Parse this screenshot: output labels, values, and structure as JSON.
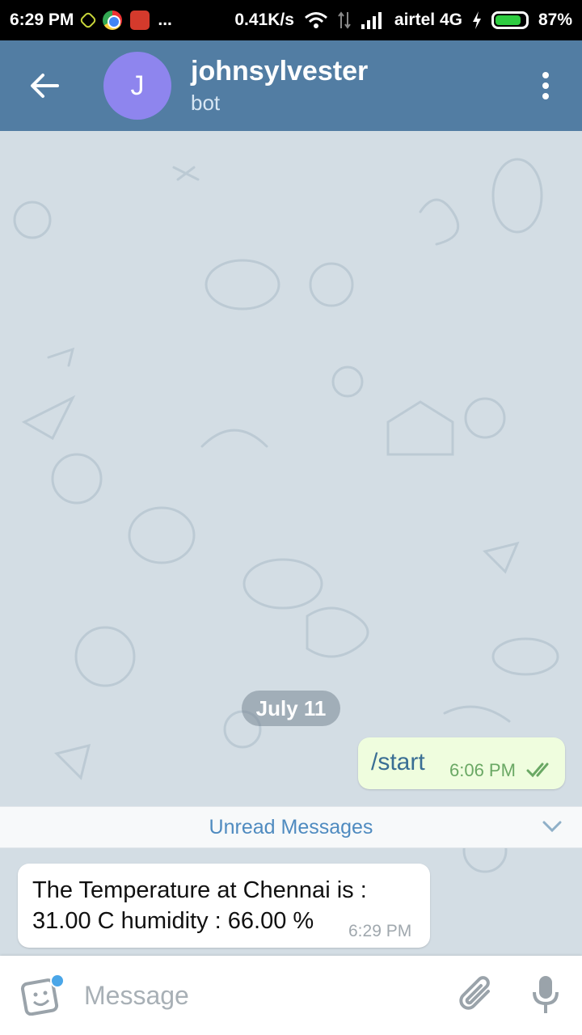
{
  "status_bar": {
    "time": "6:29 PM",
    "more": "...",
    "speed": "0.41K/s",
    "carrier": "airtel 4G",
    "battery_text": "87%",
    "battery_level": 0.87
  },
  "header": {
    "avatar_letter": "J",
    "title": "johnsylvester",
    "subtitle": "bot",
    "colors": {
      "bar": "#527da3",
      "avatar": "#8e85ee"
    }
  },
  "chat": {
    "date_label": "July 11",
    "outgoing": {
      "text": "/start",
      "time": "6:06 PM",
      "status_icon": "double-check-icon"
    },
    "unread_label": "Unread Messages",
    "incoming": {
      "text": "The Temperature at Chennai is : 31.00 C humidity : 66.00 %",
      "time": "6:29 PM"
    }
  },
  "composer": {
    "placeholder": "Message",
    "icons": [
      "sticker-icon",
      "paperclip-icon",
      "microphone-icon"
    ]
  }
}
